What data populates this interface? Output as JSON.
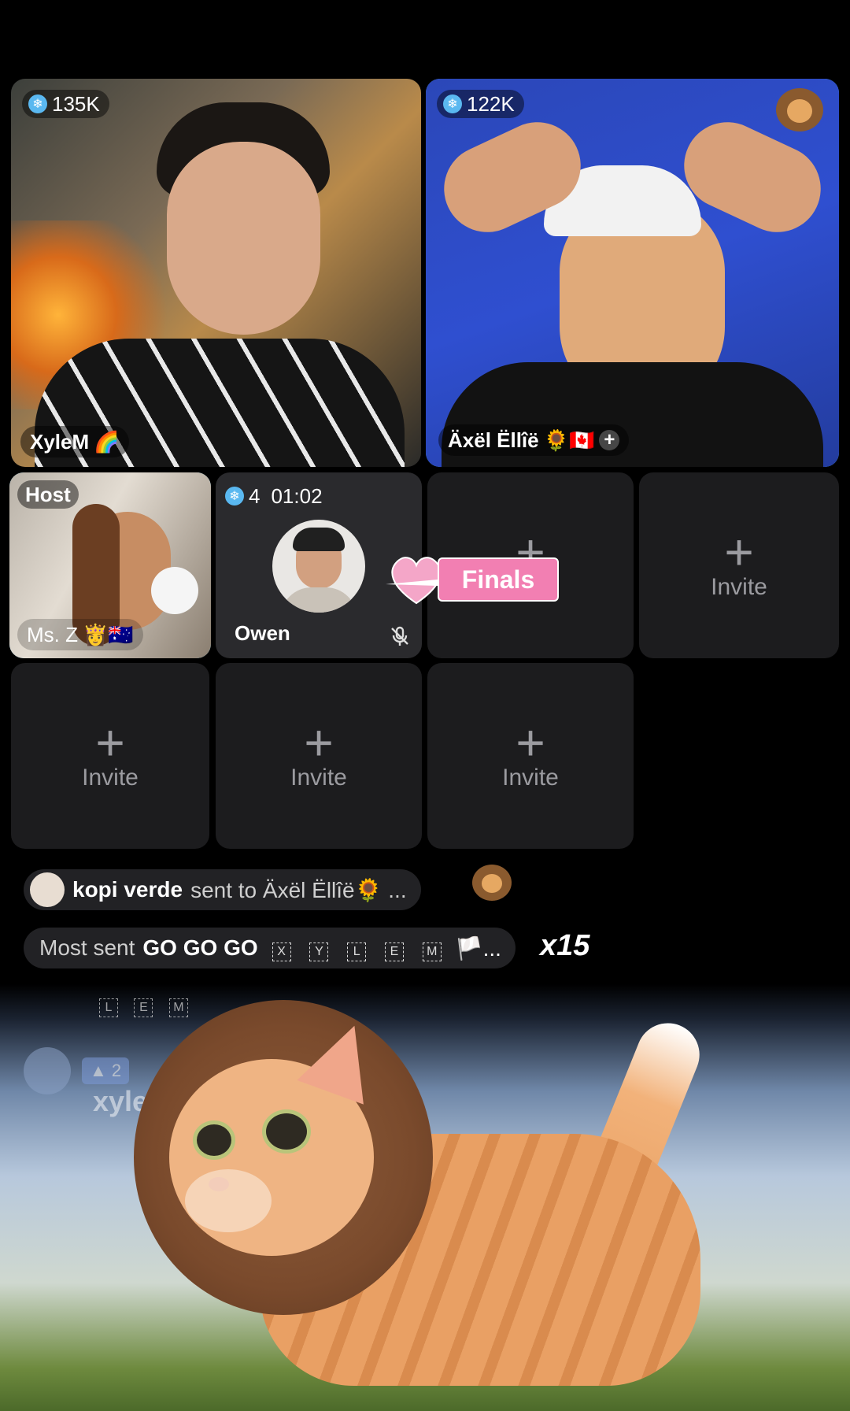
{
  "tiles": {
    "xylem": {
      "viewers": "135K",
      "name": "XyleM",
      "emoji": "🌈"
    },
    "axel": {
      "viewers": "122K",
      "name": "Äxël Ëllîë",
      "emoji": "🌻🇨🇦"
    },
    "host": {
      "role": "Host",
      "name": "Ms. Z",
      "emoji": "👸🇦🇺"
    },
    "owen": {
      "count": "4",
      "timer": "01:02",
      "name": "Owen"
    }
  },
  "finals_label": "Finals",
  "invite_label": "Invite",
  "invite_plus": "+",
  "chat": {
    "gift_sender": "kopi verde",
    "gift_text": "sent to Äxël Ëllîë🌻 ...",
    "most_sent_prefix": "Most sent",
    "most_sent_gift": "GO GO GO",
    "letters": [
      "X",
      "Y",
      "L",
      "E",
      "M"
    ],
    "ellipsis": "🏳️...",
    "multiplier": "x15",
    "letters2": [
      "L",
      "E",
      "M"
    ],
    "level": "2",
    "user_partial": "xyle"
  },
  "colors": {
    "accent": "#4fb6e6",
    "finals": "#f27fb2",
    "background": "#000000"
  }
}
